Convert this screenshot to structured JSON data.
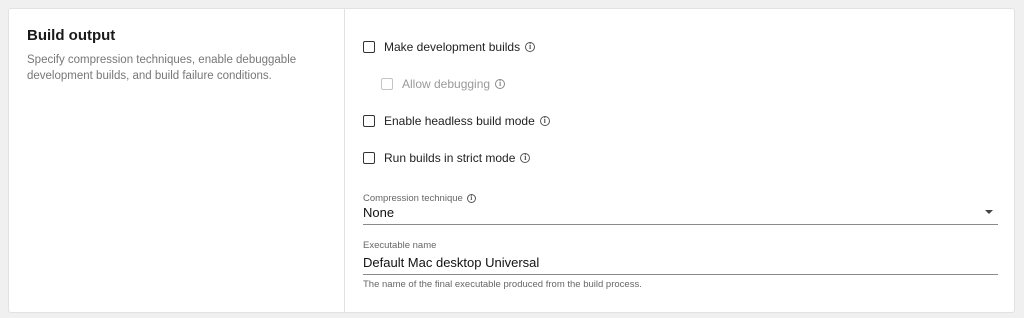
{
  "section": {
    "title": "Build output",
    "description": "Specify compression techniques, enable debuggable development builds, and build failure conditions."
  },
  "options": [
    {
      "label": "Make development builds",
      "checked": false,
      "enabled": true
    },
    {
      "label": "Allow debugging",
      "checked": false,
      "enabled": false
    },
    {
      "label": "Enable headless build mode",
      "checked": false,
      "enabled": true
    },
    {
      "label": "Run builds in strict mode",
      "checked": false,
      "enabled": true
    }
  ],
  "compression": {
    "label": "Compression technique",
    "value": "None"
  },
  "executable": {
    "label": "Executable name",
    "value": "Default Mac desktop Universal",
    "helper": "The name of the final executable produced from the build process."
  },
  "info_icon_glyph": "i"
}
